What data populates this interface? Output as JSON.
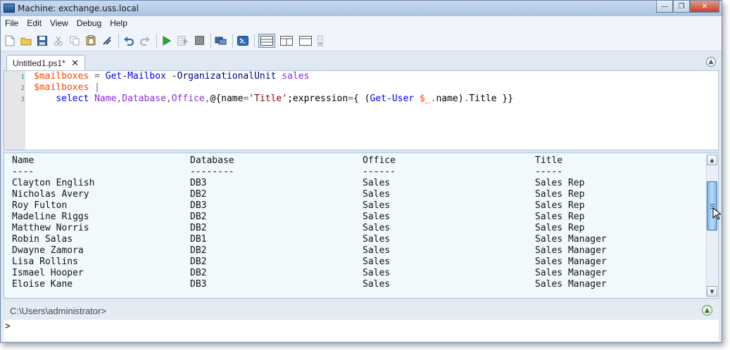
{
  "window": {
    "title": "Machine: exchange.uss.local",
    "minimize": "—",
    "maximize": "❐",
    "close": "✕"
  },
  "menu": [
    "File",
    "Edit",
    "View",
    "Debug",
    "Help"
  ],
  "toolbar_icons": [
    "new-file-icon",
    "open-folder-icon",
    "save-icon",
    "cut-icon",
    "copy-icon",
    "paste-icon",
    "clear-icon",
    "undo-icon",
    "redo-icon",
    "run-icon",
    "run-selection-icon",
    "stop-icon",
    "remote-powershell-icon",
    "powershell-console-icon",
    "layout-top-icon",
    "layout-side-icon",
    "layout-max-icon"
  ],
  "tab": {
    "label": "Untitled1.ps1*",
    "close": "✕"
  },
  "editor": {
    "line_numbers": [
      "1",
      "2",
      "3"
    ],
    "line1": {
      "var": "$mailboxes",
      "eq": " = ",
      "cmd": "Get-Mailbox",
      "param": " -OrganizationalUnit",
      "arg": " sales"
    },
    "line2": {
      "var": "$mailboxes",
      "pipe": " |"
    },
    "line3": {
      "indent": "    ",
      "cmd": "select",
      "sp": " ",
      "a1": "Name",
      "c1": ",",
      "a2": "Database",
      "c2": ",",
      "a3": "Office",
      "c3": ",",
      "hash_open": "@{",
      "k1": "name",
      "eq1": "=",
      "s1": "'Title'",
      "semi": ";",
      "k2": "expression",
      "eq2": "=",
      "brace_open": "{ (",
      "cmd2": "Get-User",
      "sp2": " ",
      "var": "$_",
      "dot": ".",
      "prop1": "name",
      "paren_close": ")",
      "dot2": ".",
      "prop2": "Title",
      "close": " }}"
    }
  },
  "output": {
    "headers": [
      "Name",
      "Database",
      "Office",
      "Title"
    ],
    "underlines": [
      "----",
      "--------",
      "------",
      "-----"
    ],
    "rows": [
      [
        "Clayton English",
        "DB3",
        "Sales",
        "Sales Rep"
      ],
      [
        "Nicholas Avery",
        "DB2",
        "Sales",
        "Sales Rep"
      ],
      [
        "Roy Fulton",
        "DB3",
        "Sales",
        "Sales Rep"
      ],
      [
        "Madeline Riggs",
        "DB2",
        "Sales",
        "Sales Rep"
      ],
      [
        "Matthew Norris",
        "DB2",
        "Sales",
        "Sales Rep"
      ],
      [
        "Robin Salas",
        "DB1",
        "Sales",
        "Sales Manager"
      ],
      [
        "Dwayne Zamora",
        "DB2",
        "Sales",
        "Sales Manager"
      ],
      [
        "Lisa Rollins",
        "DB2",
        "Sales",
        "Sales Manager"
      ],
      [
        "Ismael Hooper",
        "DB2",
        "Sales",
        "Sales Manager"
      ],
      [
        "Eloise Kane",
        "DB3",
        "Sales",
        "Sales Manager"
      ]
    ]
  },
  "prompt": {
    "path": "C:\\Users\\administrator>",
    "command_prompt": ">"
  }
}
